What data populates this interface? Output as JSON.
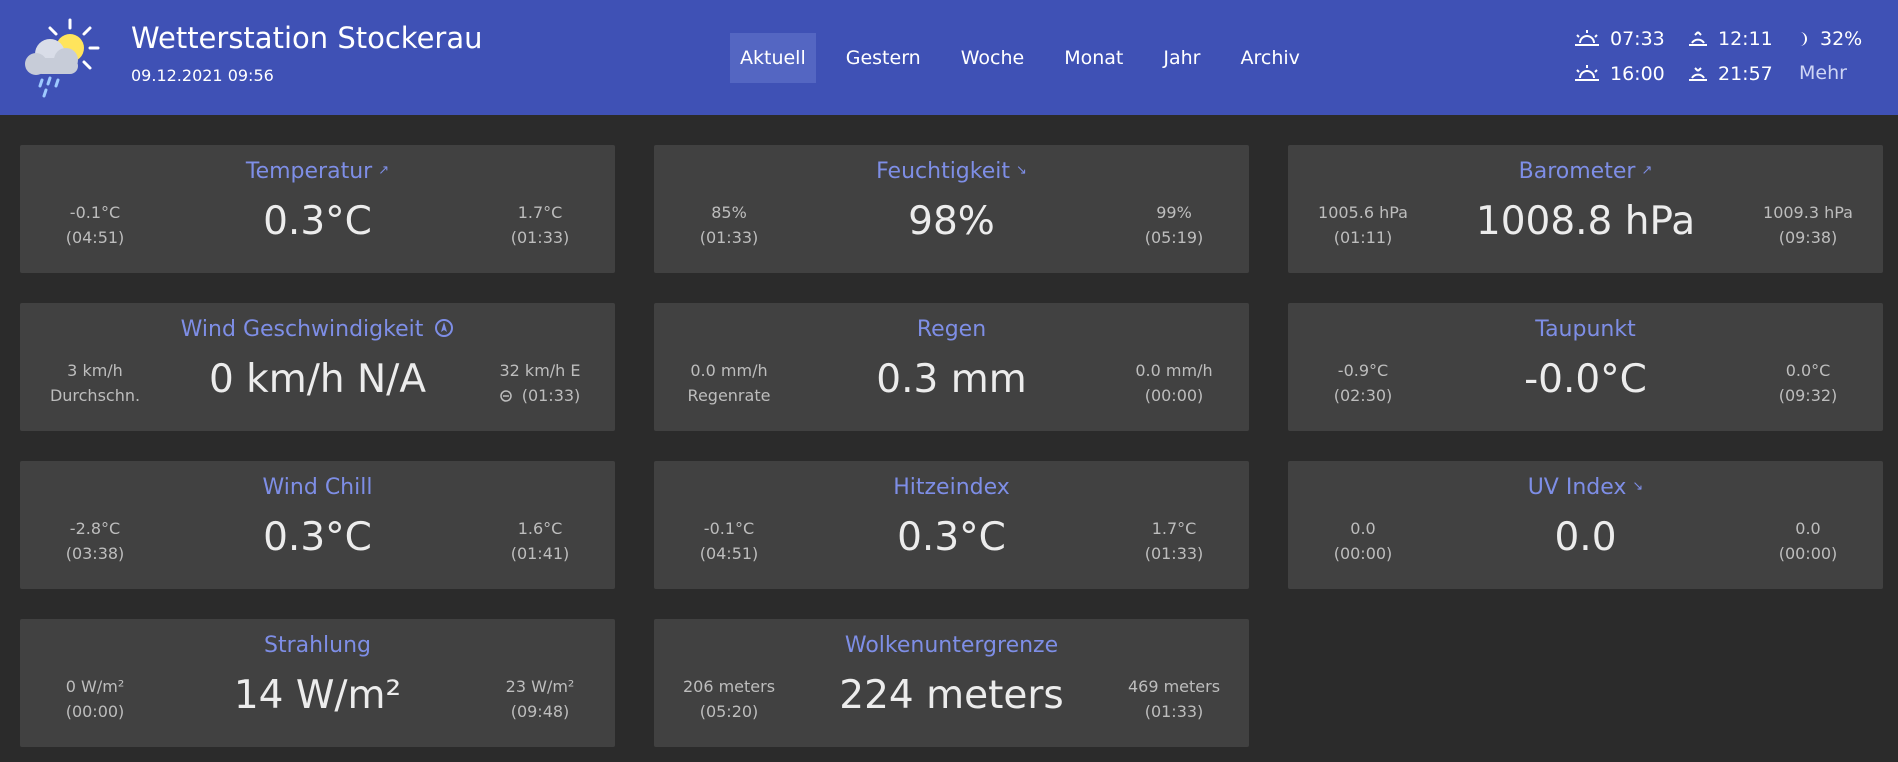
{
  "header": {
    "title": "Wetterstation Stockerau",
    "datetime": "09.12.2021 09:56",
    "logo_icon": "weather-cloud-sun-rain-icon"
  },
  "nav": {
    "items": [
      {
        "label": "Aktuell",
        "active": true
      },
      {
        "label": "Gestern"
      },
      {
        "label": "Woche"
      },
      {
        "label": "Monat"
      },
      {
        "label": "Jahr"
      },
      {
        "label": "Archiv"
      }
    ]
  },
  "astro": {
    "sunrise": "07:33",
    "sunset": "16:00",
    "moonrise": "12:11",
    "moonset": "21:57",
    "moon_phase": "32%",
    "more_label": "Mehr"
  },
  "cards": [
    {
      "title": "Temperatur",
      "trend": "↗",
      "value": "0.3°C",
      "left1": "-0.1°C",
      "left2": "(04:51)",
      "right1": "1.7°C",
      "right2": "(01:33)"
    },
    {
      "title": "Feuchtigkeit",
      "trend": "↘",
      "value": "98%",
      "left1": "85%",
      "left2": "(01:33)",
      "right1": "99%",
      "right2": "(05:19)"
    },
    {
      "title": "Barometer",
      "trend": "↗",
      "value": "1008.8 hPa",
      "left1": "1005.6 hPa",
      "left2": "(01:11)",
      "right1": "1009.3 hPa",
      "right2": "(09:38)"
    },
    {
      "title": "Wind Geschwindigkeit",
      "trend": "",
      "value": "0 km/h N/A",
      "left1": "3 km/h",
      "left2": "Durchschn.",
      "right1": "32 km/h E",
      "right2": "(01:33)"
    },
    {
      "title": "Regen",
      "trend": "",
      "value": "0.3 mm",
      "left1": "0.0 mm/h",
      "left2": "Regenrate",
      "right1": "0.0 mm/h",
      "right2": "(00:00)"
    },
    {
      "title": "Taupunkt",
      "trend": "",
      "value": "-0.0°C",
      "left1": "-0.9°C",
      "left2": "(02:30)",
      "right1": "0.0°C",
      "right2": "(09:32)"
    },
    {
      "title": "Wind Chill",
      "trend": "",
      "value": "0.3°C",
      "left1": "-2.8°C",
      "left2": "(03:38)",
      "right1": "1.6°C",
      "right2": "(01:41)"
    },
    {
      "title": "Hitzeindex",
      "trend": "",
      "value": "0.3°C",
      "left1": "-0.1°C",
      "left2": "(04:51)",
      "right1": "1.7°C",
      "right2": "(01:33)"
    },
    {
      "title": "UV Index",
      "trend": "↘",
      "value": "0.0",
      "left1": "0.0",
      "left2": "(00:00)",
      "right1": "0.0",
      "right2": "(00:00)"
    },
    {
      "title": "Strahlung",
      "trend": "",
      "value": "14 W/m²",
      "left1": "0 W/m²",
      "left2": "(00:00)",
      "right1": "23 W/m²",
      "right2": "(09:48)"
    },
    {
      "title": "Wolkenuntergrenze",
      "trend": "",
      "value": "224 meters",
      "left1": "206 meters",
      "left2": "(05:20)",
      "right1": "469 meters",
      "right2": "(01:33)"
    }
  ]
}
